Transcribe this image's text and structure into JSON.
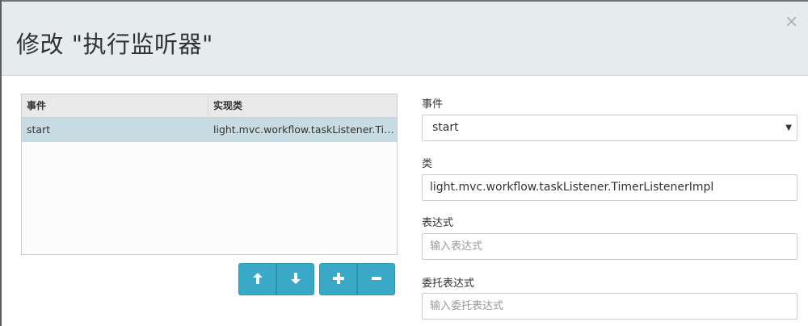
{
  "dialog": {
    "title": "修改 \"执行监听器\"",
    "close_glyph": "×"
  },
  "table": {
    "columns": [
      "事件",
      "实现类"
    ],
    "rows": [
      {
        "event": "start",
        "impl": "light.mvc.workflow.taskListener.Timer..."
      }
    ],
    "selected_row_color": "#c6dce2"
  },
  "toolbar": {
    "buttons": [
      {
        "name": "move-up",
        "icon": "arrow-up-icon"
      },
      {
        "name": "move-down",
        "icon": "arrow-down-icon"
      },
      {
        "name": "add",
        "icon": "plus-icon"
      },
      {
        "name": "remove",
        "icon": "minus-icon"
      }
    ],
    "accent_color": "#3aa9c8"
  },
  "form": {
    "event_label": "事件",
    "event_value": "start",
    "class_label": "类",
    "class_value": "light.mvc.workflow.taskListener.TimerListenerImpl",
    "expression_label": "表达式",
    "expression_placeholder": "输入表达式",
    "delegate_label": "委托表达式",
    "delegate_placeholder": "输入委托表达式"
  }
}
